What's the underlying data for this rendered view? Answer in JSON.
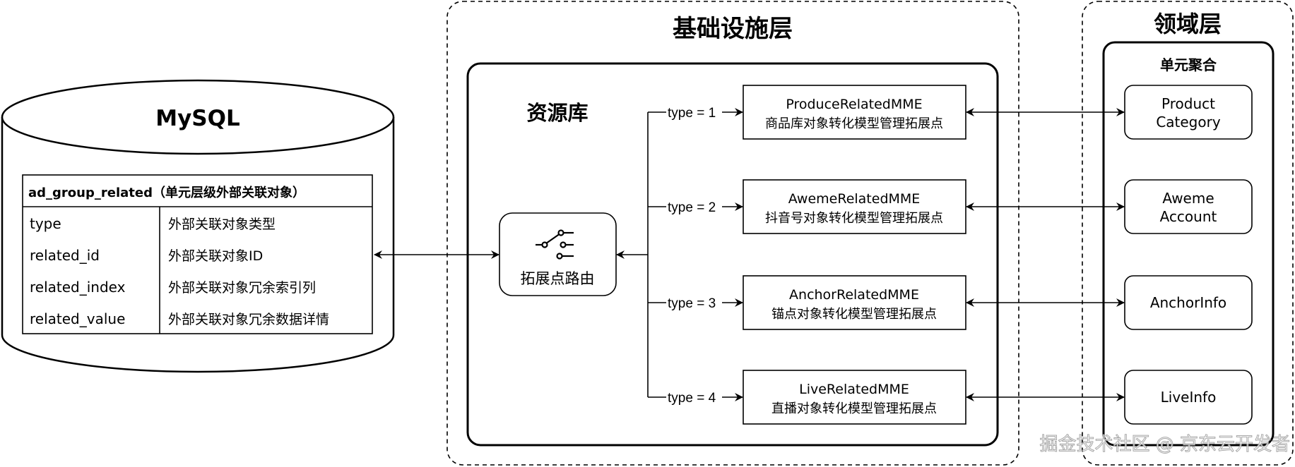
{
  "layers": {
    "infrastructure_title": "基础设施层",
    "domain_title": "领域层"
  },
  "database": {
    "name": "MySQL",
    "table": {
      "title": "ad_group_related（单元层级外部关联对象）",
      "rows": [
        {
          "field": "type",
          "desc": "外部关联对象类型"
        },
        {
          "field": "related_id",
          "desc": "外部关联对象ID"
        },
        {
          "field": "related_index",
          "desc": "外部关联对象冗余索引列"
        },
        {
          "field": "related_value",
          "desc": "外部关联对象冗余数据详情"
        }
      ]
    }
  },
  "resource_lib": {
    "title": "资源库",
    "router": {
      "label": "拓展点路由",
      "icon": "switch-icon"
    },
    "branches": [
      {
        "condition": "type = 1",
        "name": "ProduceRelatedMME",
        "desc": "商品库对象转化模型管理拓展点"
      },
      {
        "condition": "type = 2",
        "name": "AwemeRelatedMME",
        "desc": "抖音号对象转化模型管理拓展点"
      },
      {
        "condition": "type = 3",
        "name": "AnchorRelatedMME",
        "desc": "锚点对象转化模型管理拓展点"
      },
      {
        "condition": "type = 4",
        "name": "LiveRelatedMME",
        "desc": "直播对象转化模型管理拓展点"
      }
    ]
  },
  "aggregate": {
    "title": "单元聚合",
    "entities": [
      {
        "line1": "Product",
        "line2": "Category"
      },
      {
        "line1": "Aweme",
        "line2": "Account"
      },
      {
        "line1": "AnchorInfo",
        "line2": ""
      },
      {
        "line1": "LiveInfo",
        "line2": ""
      }
    ]
  },
  "watermark": "掘金技术社区 @ 京东云开发者"
}
